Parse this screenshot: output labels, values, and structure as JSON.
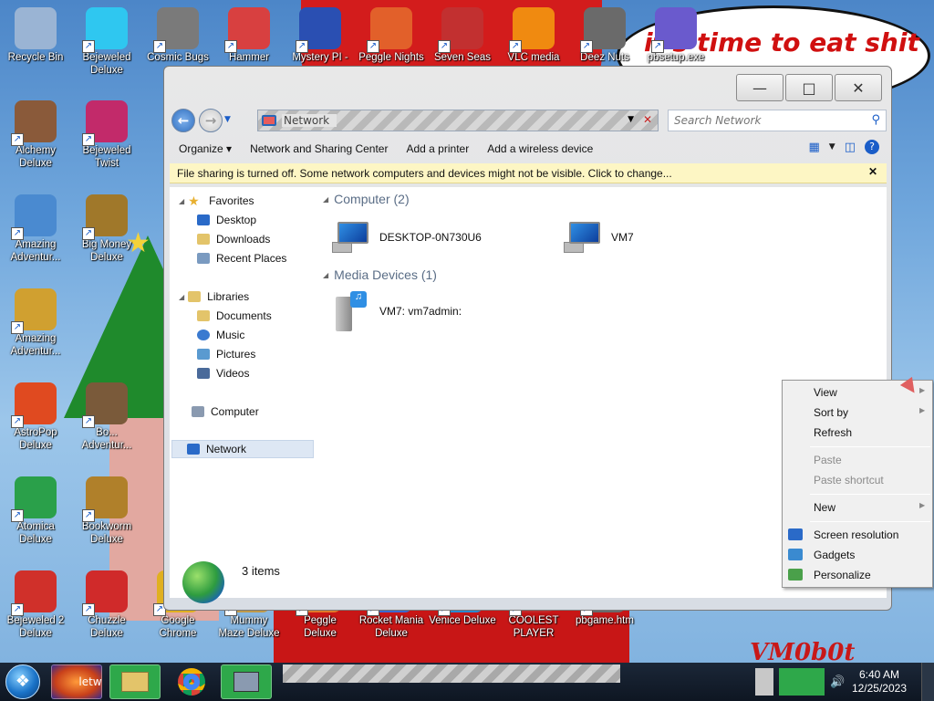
{
  "desktop": {
    "bubble_text": "it's time to eat shit",
    "signature_text": "VM0b0t",
    "icons": [
      {
        "label": "Recycle Bin",
        "color": "#9ab4d4",
        "name": "recycle-bin-icon"
      },
      {
        "label": "Bejeweled\nDeluxe",
        "color": "#2fc7f0",
        "name": "bejeweled-deluxe-icon"
      },
      {
        "label": "Cosmic Bugs",
        "color": "#7a7a7a",
        "name": "cosmic-bugs-icon"
      },
      {
        "label": "Hammer",
        "color": "#d84040",
        "name": "hammer-icon"
      },
      {
        "label": "Mystery PI -",
        "color": "#2a4fb2",
        "name": "mystery-pi-icon"
      },
      {
        "label": "Peggle Nights",
        "color": "#e2602a",
        "name": "peggle-nights-icon"
      },
      {
        "label": "Seven Seas",
        "color": "#c23030",
        "name": "seven-seas-icon"
      },
      {
        "label": "VLC media",
        "color": "#f08a10",
        "name": "vlc-media-icon"
      },
      {
        "label": "Deez Nuts",
        "color": "#6a6a6a",
        "name": "deez-nuts-icon"
      },
      {
        "label": "pbsetup.exe",
        "color": "#6a5acd",
        "name": "pbsetup-icon"
      },
      {
        "label": "Alchemy\nDeluxe",
        "color": "#8a5a3a",
        "name": "alchemy-deluxe-icon"
      },
      {
        "label": "Bejeweled\nTwist",
        "color": "#c22a6a",
        "name": "bejeweled-twist-icon"
      },
      {
        "label": "Amazing\nAdventur...",
        "color": "#4a8ad0",
        "name": "amazing-adventures-icon"
      },
      {
        "label": "Big Money\nDeluxe",
        "color": "#a0782a",
        "name": "big-money-deluxe-icon"
      },
      {
        "label": "Amazing\nAdventur...",
        "color": "#d0a030",
        "name": "amazing-adventures-2-icon"
      },
      {
        "label": "AstroPop\nDeluxe",
        "color": "#e04a20",
        "name": "astropop-deluxe-icon"
      },
      {
        "label": "Bo...\nAdventur...",
        "color": "#7a5a3a",
        "name": "bo-adventures-icon"
      },
      {
        "label": "Atomica\nDeluxe",
        "color": "#2aa04a",
        "name": "atomica-deluxe-icon"
      },
      {
        "label": "Bookworm\nDeluxe",
        "color": "#b0802a",
        "name": "bookworm-deluxe-icon"
      },
      {
        "label": "Bejeweled 2\nDeluxe",
        "color": "#d0302a",
        "name": "bejeweled-2-deluxe-icon"
      },
      {
        "label": "Chuzzle\nDeluxe",
        "color": "#d02a2a",
        "name": "chuzzle-deluxe-icon"
      },
      {
        "label": "Google\nChrome",
        "color": "#e0b020",
        "name": "google-chrome-icon"
      },
      {
        "label": "Mummy\nMaze Deluxe",
        "color": "#c09a4a",
        "name": "mummy-maze-deluxe-icon"
      },
      {
        "label": "Peggle Deluxe",
        "color": "#e07a2a",
        "name": "peggle-deluxe-icon"
      },
      {
        "label": "Rocket Mania\nDeluxe",
        "color": "#3a6ad0",
        "name": "rocket-mania-deluxe-icon"
      },
      {
        "label": "Venice Deluxe",
        "color": "#2a8ad0",
        "name": "venice-deluxe-icon"
      },
      {
        "label": "COOLEST\nPLAYER",
        "color": "#c02a2a",
        "name": "coolest-player-icon"
      },
      {
        "label": "pbgame.htm",
        "color": "#6a6a6a",
        "name": "pbgame-htm-icon"
      }
    ]
  },
  "window": {
    "address": "Network",
    "search_placeholder": "Search Network",
    "commands": [
      "Organize",
      "Network and Sharing Center",
      "Add a printer",
      "Add a wireless device"
    ],
    "infobar": "File sharing is turned off. Some network computers and devices might not be visible. Click to change...",
    "nav": {
      "favorites": "Favorites",
      "desktop": "Desktop",
      "downloads": "Downloads",
      "recent": "Recent Places",
      "libraries": "Libraries",
      "documents": "Documents",
      "music": "Music",
      "pictures": "Pictures",
      "videos": "Videos",
      "computer": "Computer",
      "network": "Network"
    },
    "groups": {
      "computer": "Computer (2)",
      "media": "Media Devices (1)"
    },
    "devices": {
      "desktop": "DESKTOP-0N730U6",
      "vm7": "VM7",
      "media": "VM7: vm7admin:"
    },
    "details_count": "3 items"
  },
  "context_menu": {
    "view": "View",
    "sort_by": "Sort by",
    "refresh": "Refresh",
    "paste": "Paste",
    "paste_shortcut": "Paste shortcut",
    "new": "New",
    "screen_resolution": "Screen resolution",
    "gadgets": "Gadgets",
    "personalize": "Personalize"
  },
  "taskbar": {
    "explorer_label": "letw",
    "time": "6:40 AM",
    "date": "12/25/2023"
  }
}
